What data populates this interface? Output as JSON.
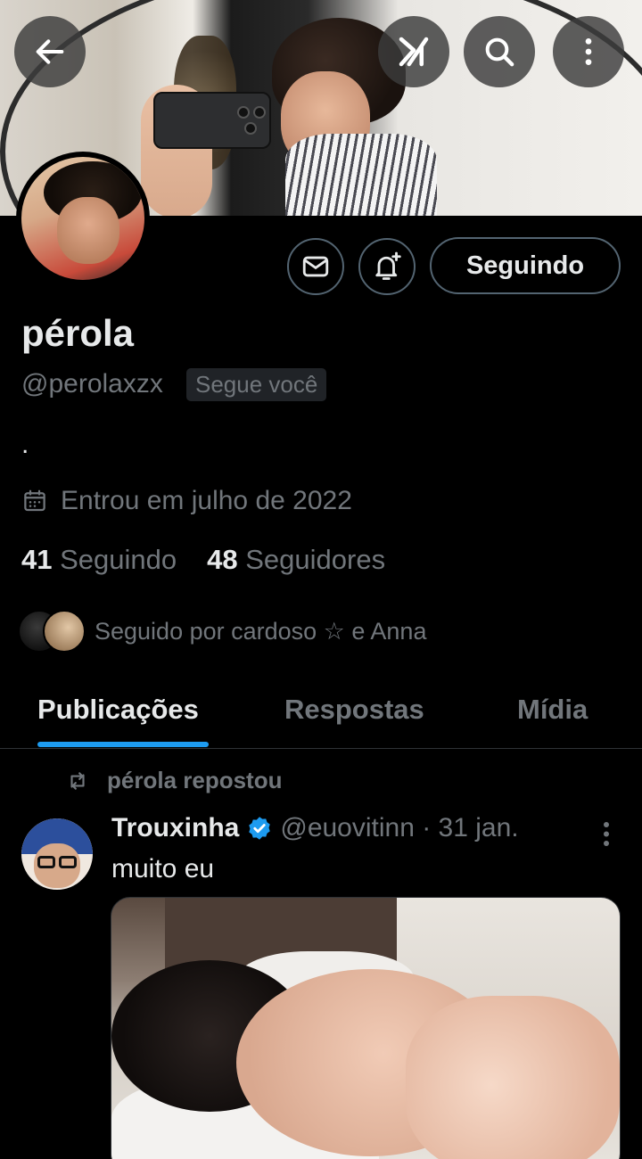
{
  "profile": {
    "name": "pérola",
    "handle": "@perolaxzx",
    "follows_you": "Segue você",
    "bio": ".",
    "joined": "Entrou em julho de 2022",
    "following_count": "41",
    "following_label": "Seguindo",
    "followers_count": "48",
    "followers_label": "Seguidores",
    "followed_by": "Seguido por cardoso ☆ e Anna"
  },
  "actions": {
    "follow_state": "Seguindo"
  },
  "tabs": [
    {
      "label": "Publicações",
      "active": true
    },
    {
      "label": "Respostas",
      "active": false
    },
    {
      "label": "Mídia",
      "active": false
    }
  ],
  "post": {
    "repost_label": "pérola repostou",
    "author": "Trouxinha",
    "meta": "@euovitinn · 31 jan.",
    "text": "muito eu"
  },
  "colors": {
    "accent": "#1d9bf0",
    "muted": "#71767b",
    "background": "#000000"
  },
  "icons": [
    "back-arrow-icon",
    "grok-icon",
    "search-icon",
    "more-vertical-icon",
    "mail-icon",
    "bell-plus-icon",
    "calendar-icon",
    "repost-icon",
    "verified-icon"
  ]
}
